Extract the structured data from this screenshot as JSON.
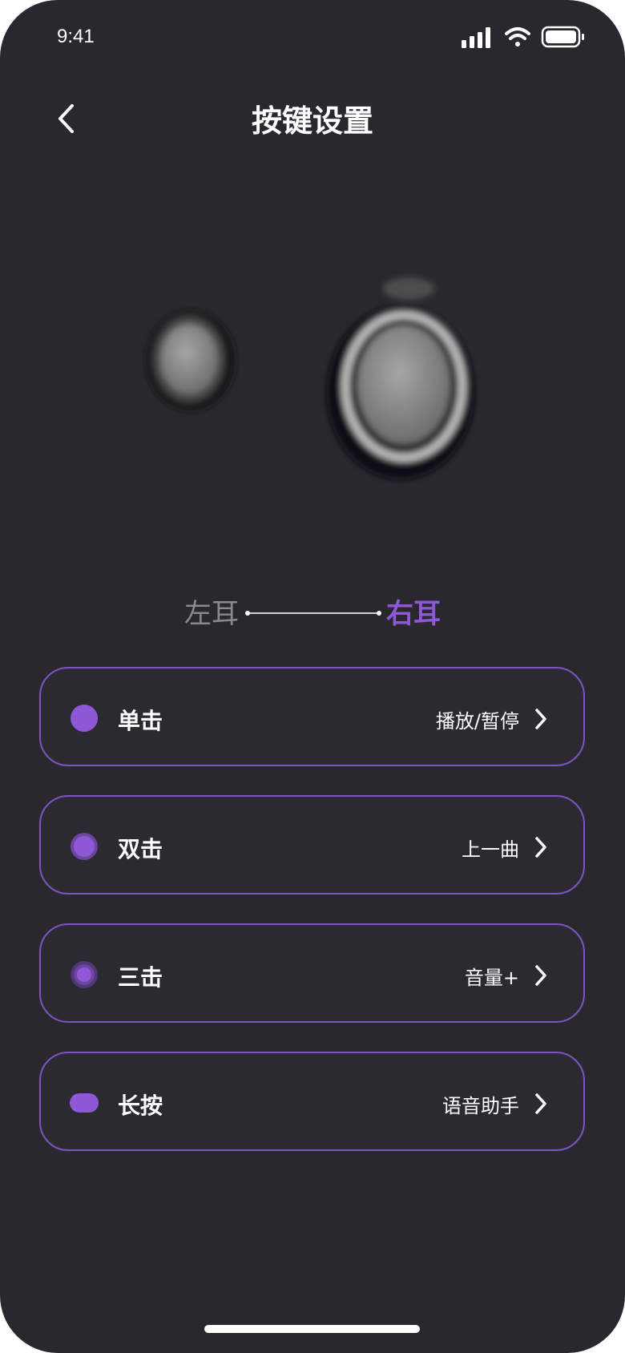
{
  "status_bar": {
    "time": "9:41"
  },
  "header": {
    "title": "按键设置"
  },
  "ear_selector": {
    "left_label": "左耳",
    "right_label": "右耳",
    "selected": "right"
  },
  "accent_color": "#8f58d6",
  "items": [
    {
      "label": "单击",
      "value": "播放/暂停",
      "icon": "single-tap-icon"
    },
    {
      "label": "双击",
      "value": "上一曲",
      "icon": "double-tap-icon"
    },
    {
      "label": "三击",
      "value": "音量+",
      "icon": "triple-tap-icon"
    },
    {
      "label": "长按",
      "value": "语音助手",
      "icon": "long-press-icon"
    }
  ]
}
